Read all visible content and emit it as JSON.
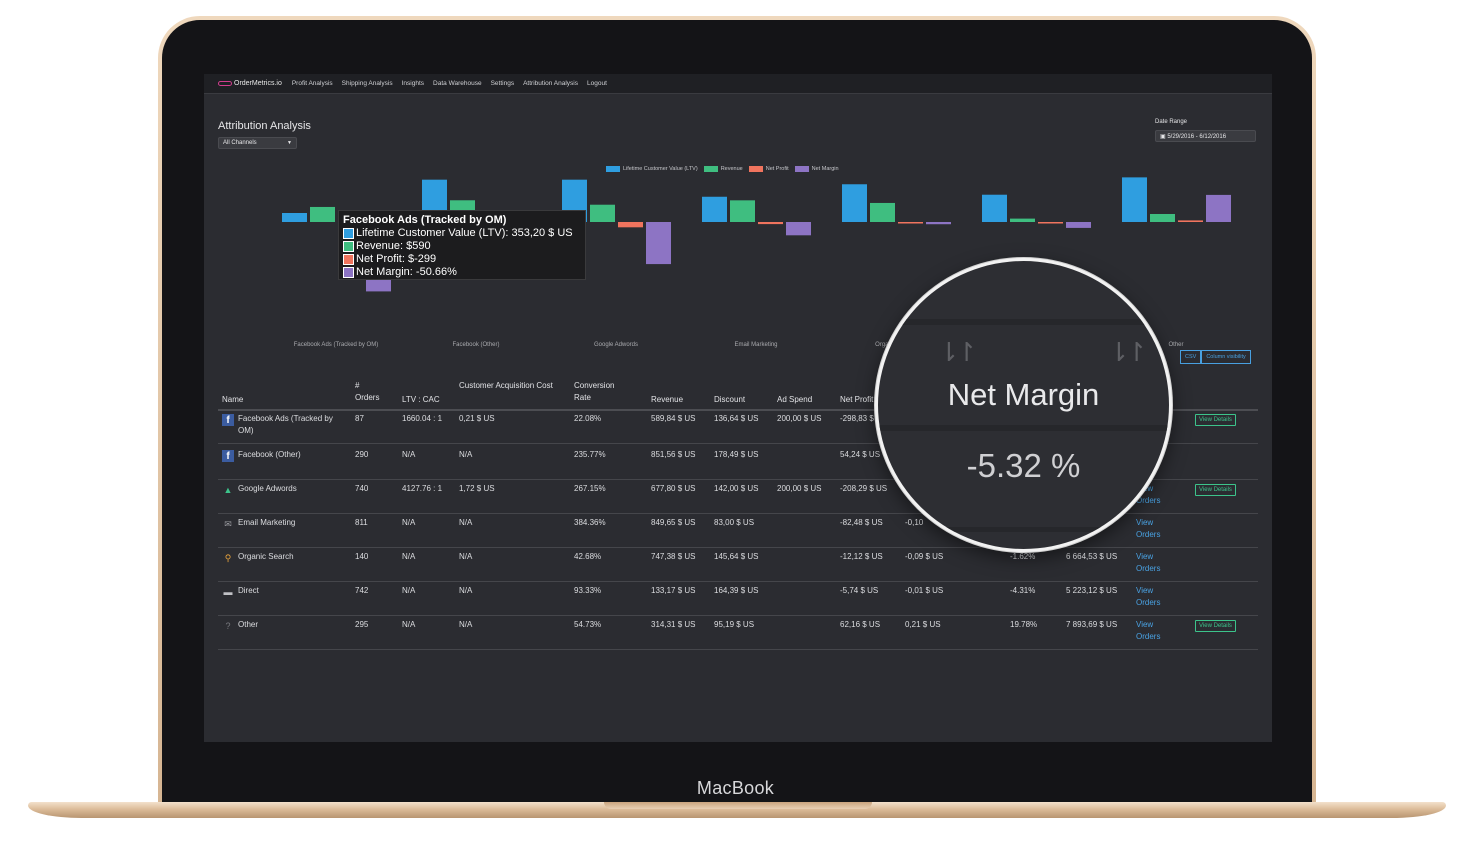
{
  "device": {
    "label": "MacBook"
  },
  "nav": {
    "logo": "OrderMetrics.io",
    "items": [
      "Profit Analysis",
      "Shipping Analysis",
      "Insights",
      "Data Warehouse",
      "Settings",
      "Attribution Analysis",
      "Logout"
    ]
  },
  "page": {
    "title": "Attribution Analysis",
    "channel_select": "All Channels",
    "date_range_label": "Date Range",
    "date_range_value": "5/29/2016 - 6/12/2016"
  },
  "chart_data": {
    "type": "bar",
    "categories": [
      "Facebook Ads (Tracked by OM)",
      "Facebook (Other)",
      "Google Adwords",
      "Email Marketing",
      "Organic Search",
      "Direct",
      "Other"
    ],
    "series": [
      {
        "name": "Lifetime Customer Value (LTV)",
        "color": "#2f9ee0",
        "values": [
          353,
          1660,
          1660,
          990,
          1480,
          1070,
          1750
        ]
      },
      {
        "name": "Revenue",
        "color": "#3fbe80",
        "values": [
          590,
          852,
          678,
          850,
          747,
          133,
          314
        ]
      },
      {
        "name": "Net Profit",
        "color": "#f0745e",
        "values": [
          -299,
          54,
          -208,
          -82,
          -12,
          -6,
          62
        ]
      },
      {
        "name": "Net Margin",
        "color": "#8d74c4",
        "values": [
          -50.66,
          6.37,
          -30.72,
          -9.71,
          -1.62,
          -4.31,
          19.78
        ]
      }
    ],
    "tooltip": {
      "title": "Facebook Ads (Tracked by OM)",
      "rows": [
        {
          "label": "Lifetime Customer Value (LTV): 353,20 $ US",
          "color": "#2f9ee0"
        },
        {
          "label": "Revenue: $590",
          "color": "#3fbe80"
        },
        {
          "label": "Net Profit: $-299",
          "color": "#f0745e"
        },
        {
          "label": "Net Margin: -50.66%",
          "color": "#8d74c4"
        }
      ]
    }
  },
  "buttons": {
    "csv": "CSV",
    "column_visibility": "Column visibility"
  },
  "table": {
    "headers": [
      "Name",
      "# Orders",
      "LTV : CAC",
      "Customer Acquisition Cost",
      "Conversion Rate",
      "Revenue",
      "Discount",
      "Ad Spend",
      "Net Profit"
    ],
    "rows": [
      {
        "name": "Facebook Ads (Tracked by OM)",
        "orders": "87",
        "ltv_cac": "1660.04 : 1",
        "cac": "0,21 $ US",
        "conv": "22.08%",
        "revenue": "589,84 $ US",
        "discount": "136,64 $ US",
        "ad_spend": "200,00 $ US",
        "net_profit": "-298,83 $ US",
        "col10": "",
        "col11": "",
        "col12": "",
        "link": "",
        "details": "View Details"
      },
      {
        "name": "Facebook (Other)",
        "orders": "290",
        "ltv_cac": "N/A",
        "cac": "N/A",
        "conv": "235.77%",
        "revenue": "851,56 $ US",
        "discount": "178,49 $ US",
        "ad_spend": "",
        "net_profit": "54,24 $ US",
        "col10": "",
        "col11": "",
        "col12": "",
        "link": "",
        "details": ""
      },
      {
        "name": "Google Adwords",
        "orders": "740",
        "ltv_cac": "4127.76 : 1",
        "cac": "1,72 $ US",
        "conv": "267.15%",
        "revenue": "677,80 $ US",
        "discount": "142,00 $ US",
        "ad_spend": "200,00 $ US",
        "net_profit": "-208,29 $ US",
        "col10": "",
        "col11": "",
        "col12": "",
        "link": "View Orders",
        "details": "View Details"
      },
      {
        "name": "Email Marketing",
        "orders": "811",
        "ltv_cac": "N/A",
        "cac": "N/A",
        "conv": "384.36%",
        "revenue": "849,65 $ US",
        "discount": "83,00 $ US",
        "ad_spend": "",
        "net_profit": "-82,48 $ US",
        "col10": "-0,10",
        "col11": "",
        "col12": "",
        "link": "View Orders",
        "details": ""
      },
      {
        "name": "Organic Search",
        "orders": "140",
        "ltv_cac": "N/A",
        "cac": "N/A",
        "conv": "42.68%",
        "revenue": "747,38 $ US",
        "discount": "145,64 $ US",
        "ad_spend": "",
        "net_profit": "-12,12 $ US",
        "col10": "-0,09 $ US",
        "col11": "-1.62%",
        "col12": "6 664,53 $ US",
        "link": "View Orders",
        "details": ""
      },
      {
        "name": "Direct",
        "orders": "742",
        "ltv_cac": "N/A",
        "cac": "N/A",
        "conv": "93.33%",
        "revenue": "133,17 $ US",
        "discount": "164,39 $ US",
        "ad_spend": "",
        "net_profit": "-5,74 $ US",
        "col10": "-0,01 $ US",
        "col11": "-4.31%",
        "col12": "5 223,12 $ US",
        "link": "View Orders",
        "details": ""
      },
      {
        "name": "Other",
        "orders": "295",
        "ltv_cac": "N/A",
        "cac": "N/A",
        "conv": "54.73%",
        "revenue": "314,31 $ US",
        "discount": "95,19 $ US",
        "ad_spend": "",
        "net_profit": "62,16 $ US",
        "col10": "0,21 $ US",
        "col11": "19.78%",
        "col12": "7 893,69 $ US",
        "link": "View Orders",
        "details": "View Details"
      }
    ],
    "icons": [
      "facebook-icon",
      "facebook-icon",
      "adwords-icon",
      "email-icon",
      "search-icon",
      "direct-icon",
      "question-icon"
    ]
  },
  "magnifier": {
    "title": "Net Margin",
    "value": "-5.32 %"
  }
}
